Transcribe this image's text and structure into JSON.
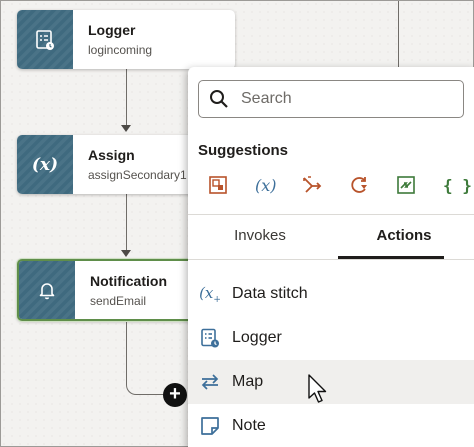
{
  "flow": {
    "nodes": [
      {
        "name": "Logger",
        "subtitle": "logincoming",
        "icon": "logger-icon"
      },
      {
        "name": "Assign",
        "subtitle": "assignSecondary1",
        "icon": "variable-icon"
      },
      {
        "name": "Notification",
        "subtitle": "sendEmail",
        "icon": "bell-icon"
      }
    ],
    "add_button_icon": "plus-icon"
  },
  "panel": {
    "search": {
      "placeholder": "Search",
      "value": ""
    },
    "suggestions_title": "Suggestions",
    "suggestions": [
      {
        "icon": "stage-file-icon",
        "color": "#b8532b"
      },
      {
        "icon": "variable-icon",
        "color": "#3d6f9a"
      },
      {
        "icon": "switch-icon",
        "color": "#b8532b"
      },
      {
        "icon": "for-each-icon",
        "color": "#b8532b"
      },
      {
        "icon": "scope-icon",
        "color": "#3d7a3a"
      },
      {
        "icon": "json-icon",
        "color": "#3d7a3a"
      }
    ],
    "tabs": [
      {
        "label": "Invokes",
        "active": false
      },
      {
        "label": "Actions",
        "active": true
      }
    ],
    "actions": [
      {
        "label": "Data stitch",
        "icon": "data-stitch-icon",
        "color": "#3d6f9a"
      },
      {
        "label": "Logger",
        "icon": "logger-icon",
        "color": "#3d6f9a"
      },
      {
        "label": "Map",
        "icon": "map-icon",
        "color": "#3d6f9a"
      },
      {
        "label": "Note",
        "icon": "note-icon",
        "color": "#3d6f9a"
      }
    ]
  }
}
